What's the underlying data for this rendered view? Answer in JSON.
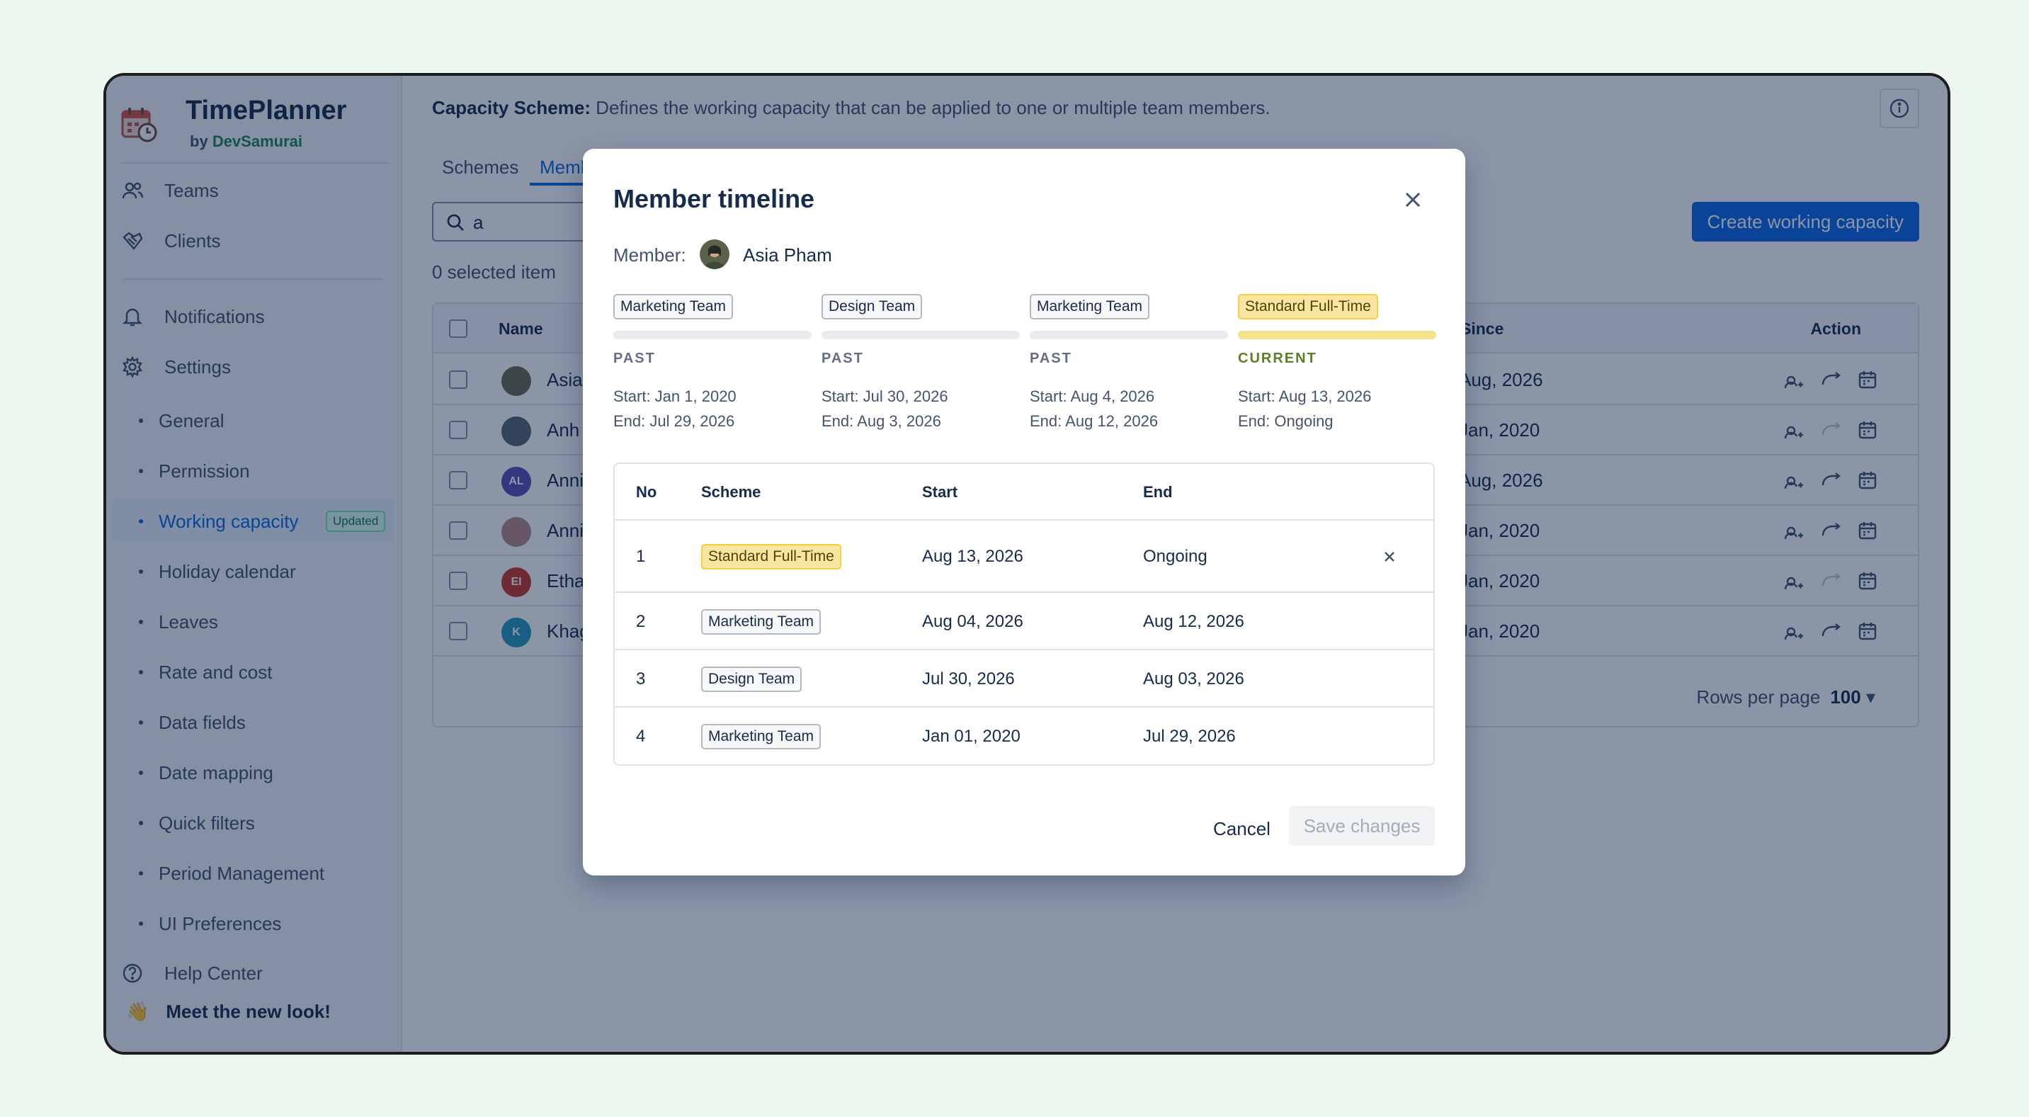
{
  "app": {
    "title": "TimePlanner",
    "by_prefix": "by",
    "by_name": "DevSamurai"
  },
  "sidebar": {
    "top_items": [
      {
        "label": "Teams",
        "icon": "people-icon"
      },
      {
        "label": "Clients",
        "icon": "handshake-icon"
      }
    ],
    "mid_items": [
      {
        "label": "Notifications",
        "icon": "bell-icon"
      },
      {
        "label": "Settings",
        "icon": "gear-icon"
      }
    ],
    "settings_items": [
      {
        "label": "General"
      },
      {
        "label": "Permission"
      },
      {
        "label": "Working capacity",
        "badge": "Updated",
        "active": true
      },
      {
        "label": "Holiday calendar"
      },
      {
        "label": "Leaves"
      },
      {
        "label": "Rate and cost"
      },
      {
        "label": "Data fields"
      },
      {
        "label": "Date mapping"
      },
      {
        "label": "Quick filters"
      },
      {
        "label": "Period Management"
      },
      {
        "label": "UI Preferences"
      }
    ],
    "help": {
      "label": "Help Center",
      "icon": "help-icon"
    },
    "meet": {
      "label": "Meet the new look!",
      "emoji": "👋"
    }
  },
  "main": {
    "scheme_label": "Capacity Scheme:",
    "scheme_desc": "Defines the working capacity that can be applied to one or multiple team members.",
    "tabs": [
      {
        "label": "Schemes"
      },
      {
        "label": "Memb",
        "selected": true
      }
    ],
    "search": {
      "value": "a"
    },
    "create_button": "Create working capacity",
    "selected_count": "0 selected item",
    "table": {
      "headers": {
        "name": "Name",
        "since": "Since",
        "action": "Action"
      },
      "rows": [
        {
          "name": "Asia",
          "since": "Aug, 2026",
          "avatar_text": "",
          "avatar_color": "#6b6b50",
          "swap_enabled": true
        },
        {
          "name": "Anh",
          "since": "Jan, 2020",
          "avatar_text": "",
          "avatar_color": "#5a6470",
          "swap_enabled": false
        },
        {
          "name": "Anni",
          "since": "Aug, 2026",
          "avatar_text": "AL",
          "avatar_color": "#5e4db2",
          "swap_enabled": true
        },
        {
          "name": "Anni",
          "since": "Jan, 2020",
          "avatar_text": "",
          "avatar_color": "#b78a86",
          "swap_enabled": true
        },
        {
          "name": "Etha",
          "since": "Jan, 2020",
          "avatar_text": "EI",
          "avatar_color": "#c9372c",
          "swap_enabled": false
        },
        {
          "name": "Khag",
          "since": "Jan, 2020",
          "avatar_text": "K",
          "avatar_color": "#2898bd",
          "swap_enabled": true
        }
      ]
    },
    "rows_per_page_label": "Rows per page",
    "rows_per_page_value": "100"
  },
  "modal": {
    "title": "Member timeline",
    "member_label": "Member:",
    "member_name": "Asia Pham",
    "timeline": [
      {
        "scheme": "Marketing Team",
        "status": "PAST",
        "start": "Start: Jan 1, 2020",
        "end": "End: Jul 29, 2026",
        "current": false
      },
      {
        "scheme": "Design Team",
        "status": "PAST",
        "start": "Start: Jul 30, 2026",
        "end": "End: Aug 3, 2026",
        "current": false
      },
      {
        "scheme": "Marketing Team",
        "status": "PAST",
        "start": "Start: Aug 4, 2026",
        "end": "End: Aug 12, 2026",
        "current": false
      },
      {
        "scheme": "Standard Full-Time",
        "status": "CURRENT",
        "start": "Start: Aug 13, 2026",
        "end": "End: Ongoing",
        "current": true
      }
    ],
    "table": {
      "headers": {
        "no": "No",
        "scheme": "Scheme",
        "start": "Start",
        "end": "End"
      },
      "rows": [
        {
          "no": "1",
          "scheme": "Standard Full-Time",
          "start": "Aug 13, 2026",
          "end": "Ongoing",
          "highlight": true,
          "removable": true
        },
        {
          "no": "2",
          "scheme": "Marketing Team",
          "start": "Aug 04, 2026",
          "end": "Aug 12, 2026",
          "highlight": false,
          "removable": false
        },
        {
          "no": "3",
          "scheme": "Design Team",
          "start": "Jul 30, 2026",
          "end": "Aug 03, 2026",
          "highlight": false,
          "removable": false
        },
        {
          "no": "4",
          "scheme": "Marketing Team",
          "start": "Jan 01, 2020",
          "end": "Jul 29, 2026",
          "highlight": false,
          "removable": false
        }
      ]
    },
    "cancel_label": "Cancel",
    "save_label": "Save changes"
  },
  "colors": {
    "accent": "#0c66e4",
    "current_lozenge": "#f8e6a0",
    "current_status": "#5b7f24"
  }
}
